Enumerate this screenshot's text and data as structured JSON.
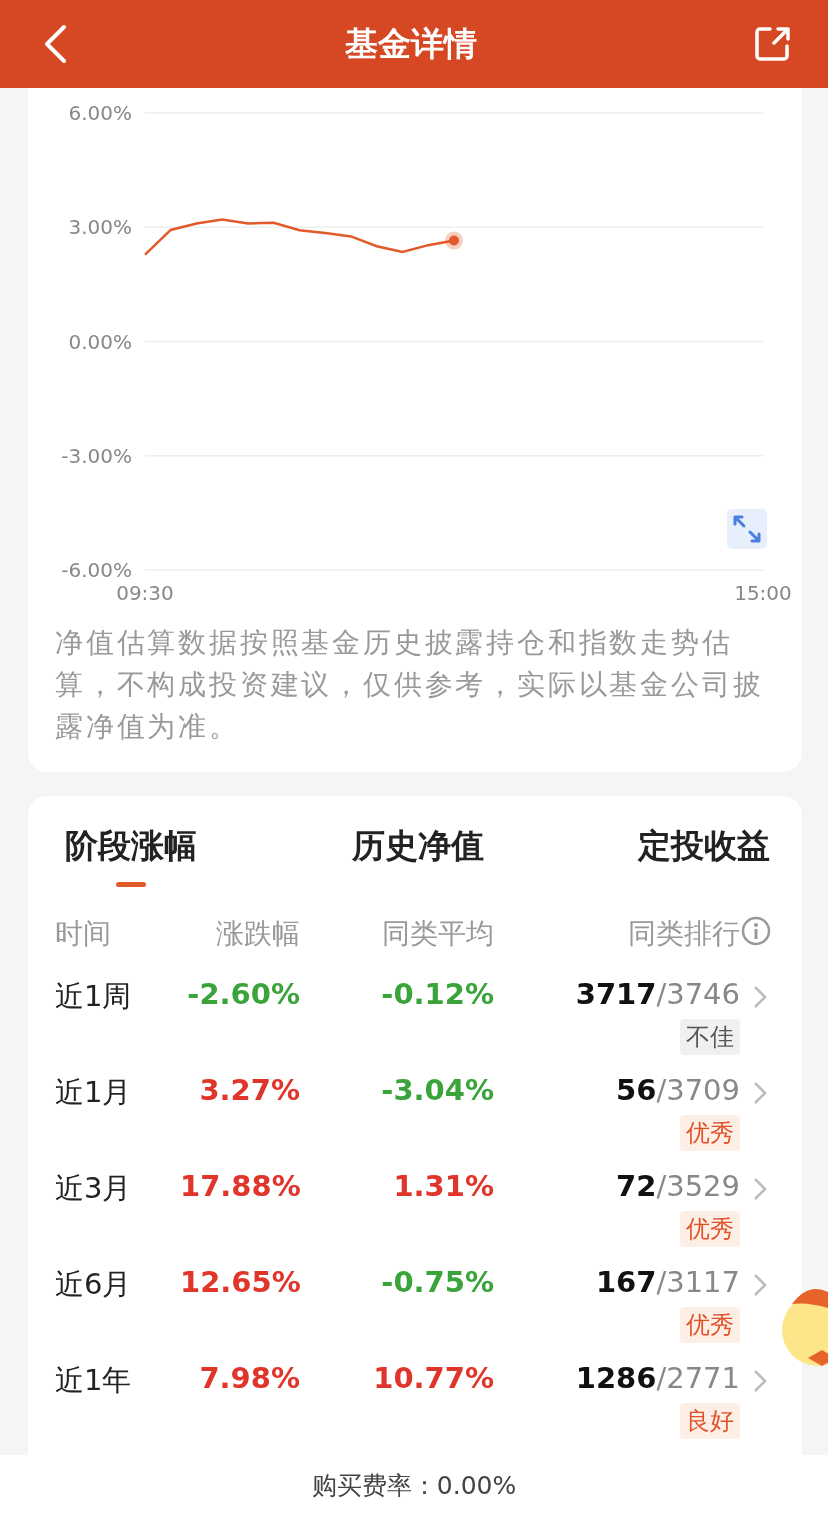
{
  "header": {
    "title": "基金详情"
  },
  "chart": {
    "chart_data": {
      "type": "line",
      "categories": [
        "09:30",
        null,
        null,
        null,
        null,
        null,
        null,
        null,
        null,
        null,
        null,
        null,
        null,
        null,
        null,
        null,
        null,
        null,
        null,
        null,
        null,
        null,
        null,
        null,
        "15:00"
      ],
      "series": [
        {
          "color": "#e2592a",
          "values": [
            2.28,
            2.93,
            3.1,
            3.2,
            3.1,
            3.12,
            2.92,
            2.85,
            2.76,
            2.5,
            2.35,
            2.53,
            2.65,
            null,
            null,
            null,
            null,
            null,
            null,
            null,
            null,
            null,
            null,
            null,
            null
          ]
        }
      ],
      "ylim": [
        -6,
        6
      ],
      "grid": true,
      "yticks": [
        {
          "value": 6,
          "label": "6.00%"
        },
        {
          "value": 3,
          "label": "3.00%"
        },
        {
          "value": 0,
          "label": "0.00%"
        },
        {
          "value": -3,
          "label": "-3.00%"
        },
        {
          "value": -6,
          "label": "-6.00%"
        }
      ]
    },
    "note": "净值估算数据按照基金历史披露持仓和指数走势估算，不构成投资建议，仅供参考，实际以基金公司披露净值为准。"
  },
  "tabs": [
    {
      "label": "阶段涨幅",
      "selected": true
    },
    {
      "label": "历史净值",
      "selected": false
    },
    {
      "label": "定投收益",
      "selected": false
    }
  ],
  "table": {
    "columns": [
      "时间",
      "涨跌幅",
      "同类平均",
      "同类排行"
    ],
    "rows": [
      {
        "period": "近1周",
        "change": {
          "text": "-2.60%",
          "color": "#3aa33a"
        },
        "average": {
          "text": "-0.12%",
          "color": "#3aa33a"
        },
        "rank": "3717",
        "total": "/3746",
        "tag": {
          "text": "不佳",
          "kind": "neutral"
        }
      },
      {
        "period": "近1月",
        "change": {
          "text": "3.27%",
          "color": "#e0352b"
        },
        "average": {
          "text": "-3.04%",
          "color": "#3aa33a"
        },
        "rank": "56",
        "total": "/3709",
        "tag": {
          "text": "优秀",
          "kind": "positive"
        }
      },
      {
        "period": "近3月",
        "change": {
          "text": "17.88%",
          "color": "#e0352b"
        },
        "average": {
          "text": "1.31%",
          "color": "#e0352b"
        },
        "rank": "72",
        "total": "/3529",
        "tag": {
          "text": "优秀",
          "kind": "positive"
        }
      },
      {
        "period": "近6月",
        "change": {
          "text": "12.65%",
          "color": "#e0352b"
        },
        "average": {
          "text": "-0.75%",
          "color": "#3aa33a"
        },
        "rank": "167",
        "total": "/3117",
        "tag": {
          "text": "优秀",
          "kind": "positive"
        }
      },
      {
        "period": "近1年",
        "change": {
          "text": "7.98%",
          "color": "#e0352b"
        },
        "average": {
          "text": "10.77%",
          "color": "#e0352b"
        },
        "rank": "1286",
        "total": "/2771",
        "tag": {
          "text": "良好",
          "kind": "positive"
        }
      }
    ]
  },
  "footer": {
    "text": "购买费率：0.00%"
  }
}
